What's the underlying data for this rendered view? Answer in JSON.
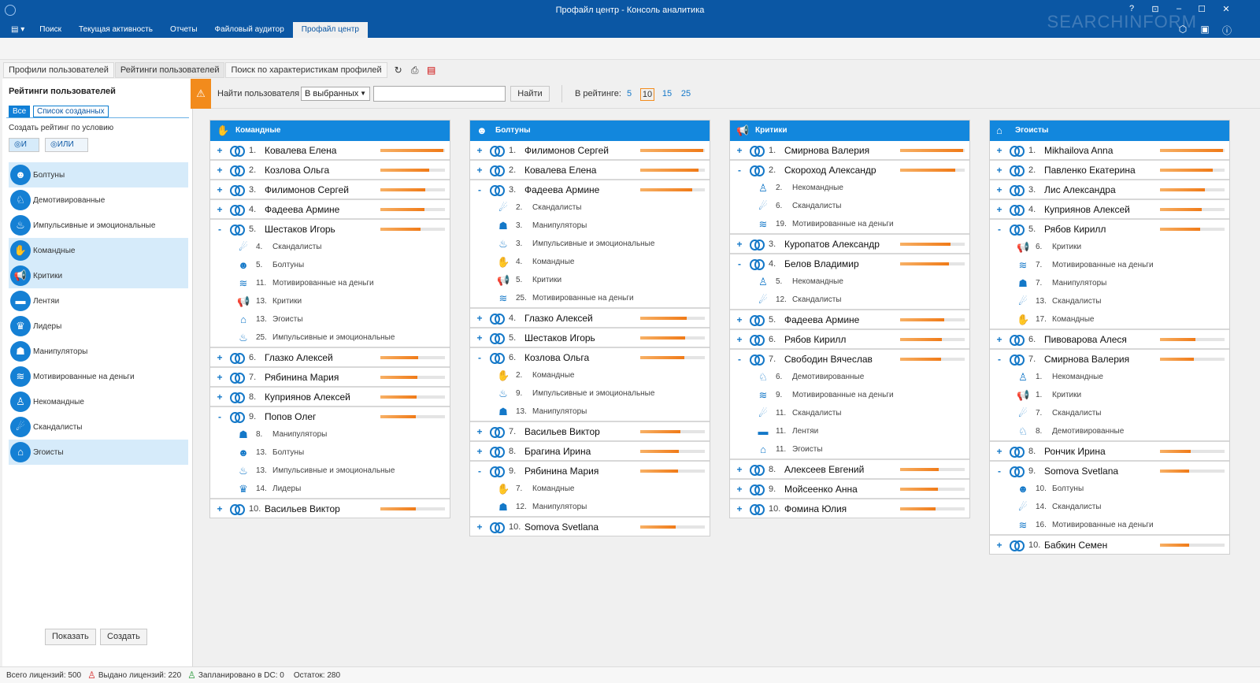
{
  "window": {
    "title": "Профайл центр - Консоль аналитика",
    "brand": "SEARCHINFORM",
    "controls": [
      "?",
      "⊡",
      "–",
      "☐",
      "✕"
    ]
  },
  "ribbon": {
    "menu": "▤ ▾",
    "tabs": [
      "Поиск",
      "Текущая активность",
      "Отчеты",
      "Файловый аудитор",
      "Профайл центр"
    ],
    "active": 4
  },
  "subtabs": [
    "Профили пользователей",
    "Рейтинги пользователей",
    "Поиск по характеристикам профилей"
  ],
  "sidebar": {
    "title": "Рейтинги пользователей",
    "filter_all": "Все",
    "filter_created": "Список созданных",
    "condition_label": "Создать рейтинг по условию",
    "and_label": "◎И",
    "or_label": "◎ИЛИ",
    "categories": [
      {
        "label": "Болтуны",
        "selected": true,
        "icon": "talker-icon"
      },
      {
        "label": "Демотивированные",
        "selected": false,
        "icon": "demotivated-icon"
      },
      {
        "label": "Импульсивные и эмоциональные",
        "selected": false,
        "icon": "impulsive-icon"
      },
      {
        "label": "Командные",
        "selected": true,
        "icon": "handshake-icon"
      },
      {
        "label": "Критики",
        "selected": true,
        "icon": "megaphone-icon"
      },
      {
        "label": "Лентяи",
        "selected": false,
        "icon": "bed-icon"
      },
      {
        "label": "Лидеры",
        "selected": false,
        "icon": "trophy-icon"
      },
      {
        "label": "Манипуляторы",
        "selected": false,
        "icon": "mask-icon"
      },
      {
        "label": "Мотивированные на деньги",
        "selected": false,
        "icon": "coins-icon"
      },
      {
        "label": "Некомандные",
        "selected": false,
        "icon": "lonely-icon"
      },
      {
        "label": "Скандалисты",
        "selected": false,
        "icon": "scandal-icon"
      },
      {
        "label": "Эгоисты",
        "selected": true,
        "icon": "house-icon"
      }
    ],
    "show_button": "Показать",
    "create_button": "Создать"
  },
  "search": {
    "label": "Найти пользователя",
    "scope": "В выбранных",
    "input_value": "",
    "find_button": "Найти",
    "rating_label": "В рейтинге:",
    "rating_options": [
      "5",
      "10",
      "15",
      "25"
    ],
    "rating_selected": "10"
  },
  "columns": [
    {
      "title": "Командные",
      "icon": "handshake-icon",
      "groups": [
        {
          "rank": "1.",
          "name": "Ковалева Елена",
          "expand": "+",
          "score": 0.98,
          "subs": []
        },
        {
          "rank": "2.",
          "name": "Козлова Ольга",
          "expand": "+",
          "score": 0.75,
          "subs": []
        },
        {
          "rank": "3.",
          "name": "Филимонов Сергей",
          "expand": "+",
          "score": 0.7,
          "subs": []
        },
        {
          "rank": "4.",
          "name": "Фадеева Армине",
          "expand": "+",
          "score": 0.68,
          "subs": []
        },
        {
          "rank": "5.",
          "name": "Шестаков Игорь",
          "expand": "-",
          "score": 0.62,
          "subs": [
            {
              "rank": "4.",
              "label": "Скандалисты",
              "icon": "scandal-icon"
            },
            {
              "rank": "5.",
              "label": "Болтуны",
              "icon": "talker-icon"
            },
            {
              "rank": "11.",
              "label": "Мотивированные на деньги",
              "icon": "coins-icon"
            },
            {
              "rank": "13.",
              "label": "Критики",
              "icon": "megaphone-icon"
            },
            {
              "rank": "13.",
              "label": "Эгоисты",
              "icon": "house-icon"
            },
            {
              "rank": "25.",
              "label": "Импульсивные и эмоциональные",
              "icon": "impulsive-icon"
            }
          ]
        },
        {
          "rank": "6.",
          "name": "Глазко Алексей",
          "expand": "+",
          "score": 0.58,
          "subs": []
        },
        {
          "rank": "7.",
          "name": "Рябинина Мария",
          "expand": "+",
          "score": 0.57,
          "subs": []
        },
        {
          "rank": "8.",
          "name": "Куприянов Алексей",
          "expand": "+",
          "score": 0.56,
          "subs": []
        },
        {
          "rank": "9.",
          "name": "Попов Олег",
          "expand": "-",
          "score": 0.55,
          "subs": [
            {
              "rank": "8.",
              "label": "Манипуляторы",
              "icon": "mask-icon"
            },
            {
              "rank": "13.",
              "label": "Болтуны",
              "icon": "talker-icon"
            },
            {
              "rank": "13.",
              "label": "Импульсивные и эмоциональные",
              "icon": "impulsive-icon"
            },
            {
              "rank": "14.",
              "label": "Лидеры",
              "icon": "trophy-icon"
            }
          ]
        },
        {
          "rank": "10.",
          "name": "Васильев Виктор",
          "expand": "+",
          "score": 0.55,
          "subs": []
        }
      ]
    },
    {
      "title": "Болтуны",
      "icon": "talker-icon",
      "groups": [
        {
          "rank": "1.",
          "name": "Филимонов Сергей",
          "expand": "+",
          "score": 0.98,
          "subs": []
        },
        {
          "rank": "2.",
          "name": "Ковалева Елена",
          "expand": "+",
          "score": 0.9,
          "subs": []
        },
        {
          "rank": "3.",
          "name": "Фадеева Армине",
          "expand": "-",
          "score": 0.8,
          "subs": [
            {
              "rank": "2.",
              "label": "Скандалисты",
              "icon": "scandal-icon"
            },
            {
              "rank": "3.",
              "label": "Манипуляторы",
              "icon": "mask-icon"
            },
            {
              "rank": "3.",
              "label": "Импульсивные и эмоциональные",
              "icon": "impulsive-icon"
            },
            {
              "rank": "4.",
              "label": "Командные",
              "icon": "handshake-icon"
            },
            {
              "rank": "5.",
              "label": "Критики",
              "icon": "megaphone-icon"
            },
            {
              "rank": "25.",
              "label": "Мотивированные на деньги",
              "icon": "coins-icon"
            }
          ]
        },
        {
          "rank": "4.",
          "name": "Глазко Алексей",
          "expand": "+",
          "score": 0.72,
          "subs": []
        },
        {
          "rank": "5.",
          "name": "Шестаков Игорь",
          "expand": "+",
          "score": 0.7,
          "subs": []
        },
        {
          "rank": "6.",
          "name": "Козлова Ольга",
          "expand": "-",
          "score": 0.68,
          "subs": [
            {
              "rank": "2.",
              "label": "Командные",
              "icon": "handshake-icon"
            },
            {
              "rank": "9.",
              "label": "Импульсивные и эмоциональные",
              "icon": "impulsive-icon"
            },
            {
              "rank": "13.",
              "label": "Манипуляторы",
              "icon": "mask-icon"
            }
          ]
        },
        {
          "rank": "7.",
          "name": "Васильев Виктор",
          "expand": "+",
          "score": 0.62,
          "subs": []
        },
        {
          "rank": "8.",
          "name": "Брагина Ирина",
          "expand": "+",
          "score": 0.6,
          "subs": []
        },
        {
          "rank": "9.",
          "name": "Рябинина Мария",
          "expand": "-",
          "score": 0.58,
          "subs": [
            {
              "rank": "7.",
              "label": "Командные",
              "icon": "handshake-icon"
            },
            {
              "rank": "12.",
              "label": "Манипуляторы",
              "icon": "mask-icon"
            }
          ]
        },
        {
          "rank": "10.",
          "name": "Somova Svetlana",
          "expand": "+",
          "score": 0.55,
          "subs": []
        }
      ]
    },
    {
      "title": "Критики",
      "icon": "megaphone-icon",
      "groups": [
        {
          "rank": "1.",
          "name": "Смирнова Валерия",
          "expand": "+",
          "score": 0.98,
          "subs": []
        },
        {
          "rank": "2.",
          "name": "Скороход Александр",
          "expand": "-",
          "score": 0.85,
          "subs": [
            {
              "rank": "2.",
              "label": "Некомандные",
              "icon": "lonely-icon"
            },
            {
              "rank": "6.",
              "label": "Скандалисты",
              "icon": "scandal-icon"
            },
            {
              "rank": "19.",
              "label": "Мотивированные на деньги",
              "icon": "coins-icon"
            }
          ]
        },
        {
          "rank": "3.",
          "name": "Куропатов Александр",
          "expand": "+",
          "score": 0.78,
          "subs": []
        },
        {
          "rank": "4.",
          "name": "Белов Владимир",
          "expand": "-",
          "score": 0.75,
          "subs": [
            {
              "rank": "5.",
              "label": "Некомандные",
              "icon": "lonely-icon"
            },
            {
              "rank": "12.",
              "label": "Скандалисты",
              "icon": "scandal-icon"
            }
          ]
        },
        {
          "rank": "5.",
          "name": "Фадеева Армине",
          "expand": "+",
          "score": 0.68,
          "subs": []
        },
        {
          "rank": "6.",
          "name": "Рябов Кирилл",
          "expand": "+",
          "score": 0.65,
          "subs": []
        },
        {
          "rank": "7.",
          "name": "Свободин Вячеслав",
          "expand": "-",
          "score": 0.63,
          "subs": [
            {
              "rank": "6.",
              "label": "Демотивированные",
              "icon": "demotivated-icon"
            },
            {
              "rank": "9.",
              "label": "Мотивированные на деньги",
              "icon": "coins-icon"
            },
            {
              "rank": "11.",
              "label": "Скандалисты",
              "icon": "scandal-icon"
            },
            {
              "rank": "11.",
              "label": "Лентяи",
              "icon": "bed-icon"
            },
            {
              "rank": "11.",
              "label": "Эгоисты",
              "icon": "house-icon"
            }
          ]
        },
        {
          "rank": "8.",
          "name": "Алексеев Евгений",
          "expand": "+",
          "score": 0.6,
          "subs": []
        },
        {
          "rank": "9.",
          "name": "Мойсеенко Анна",
          "expand": "+",
          "score": 0.58,
          "subs": []
        },
        {
          "rank": "10.",
          "name": "Фомина Юлия",
          "expand": "+",
          "score": 0.55,
          "subs": []
        }
      ]
    },
    {
      "title": "Эгоисты",
      "icon": "house-icon",
      "groups": [
        {
          "rank": "1.",
          "name": "Mikhailova Anna",
          "expand": "+",
          "score": 0.98,
          "subs": []
        },
        {
          "rank": "2.",
          "name": "Павленко Екатерина",
          "expand": "+",
          "score": 0.82,
          "subs": []
        },
        {
          "rank": "3.",
          "name": "Лис Александра",
          "expand": "+",
          "score": 0.7,
          "subs": []
        },
        {
          "rank": "4.",
          "name": "Куприянов Алексей",
          "expand": "+",
          "score": 0.65,
          "subs": []
        },
        {
          "rank": "5.",
          "name": "Рябов Кирилл",
          "expand": "-",
          "score": 0.62,
          "subs": [
            {
              "rank": "6.",
              "label": "Критики",
              "icon": "megaphone-icon"
            },
            {
              "rank": "7.",
              "label": "Мотивированные на деньги",
              "icon": "coins-icon"
            },
            {
              "rank": "7.",
              "label": "Манипуляторы",
              "icon": "mask-icon"
            },
            {
              "rank": "13.",
              "label": "Скандалисты",
              "icon": "scandal-icon"
            },
            {
              "rank": "17.",
              "label": "Командные",
              "icon": "handshake-icon"
            }
          ]
        },
        {
          "rank": "6.",
          "name": "Пивоварова Алеся",
          "expand": "+",
          "score": 0.55,
          "subs": []
        },
        {
          "rank": "7.",
          "name": "Смирнова Валерия",
          "expand": "-",
          "score": 0.53,
          "subs": [
            {
              "rank": "1.",
              "label": "Некомандные",
              "icon": "lonely-icon"
            },
            {
              "rank": "1.",
              "label": "Критики",
              "icon": "megaphone-icon"
            },
            {
              "rank": "7.",
              "label": "Скандалисты",
              "icon": "scandal-icon"
            },
            {
              "rank": "8.",
              "label": "Демотивированные",
              "icon": "demotivated-icon"
            }
          ]
        },
        {
          "rank": "8.",
          "name": "Рончик Ирина",
          "expand": "+",
          "score": 0.48,
          "subs": []
        },
        {
          "rank": "9.",
          "name": "Somova Svetlana",
          "expand": "-",
          "score": 0.45,
          "subs": [
            {
              "rank": "10.",
              "label": "Болтуны",
              "icon": "talker-icon"
            },
            {
              "rank": "14.",
              "label": "Скандалисты",
              "icon": "scandal-icon"
            },
            {
              "rank": "16.",
              "label": "Мотивированные на деньги",
              "icon": "coins-icon"
            }
          ]
        },
        {
          "rank": "10.",
          "name": "Бабкин Семен",
          "expand": "+",
          "score": 0.45,
          "subs": []
        }
      ]
    }
  ],
  "statusbar": {
    "total": "Всего лицензий: 500",
    "issued": "Выдано лицензий: 220",
    "planned": "Запланировано в DC: 0",
    "remaining": "Остаток: 280"
  },
  "colors": {
    "accent": "#0b57a4",
    "header": "#1287dd",
    "bar": "#f07a17",
    "flag": "#f28b1c"
  }
}
